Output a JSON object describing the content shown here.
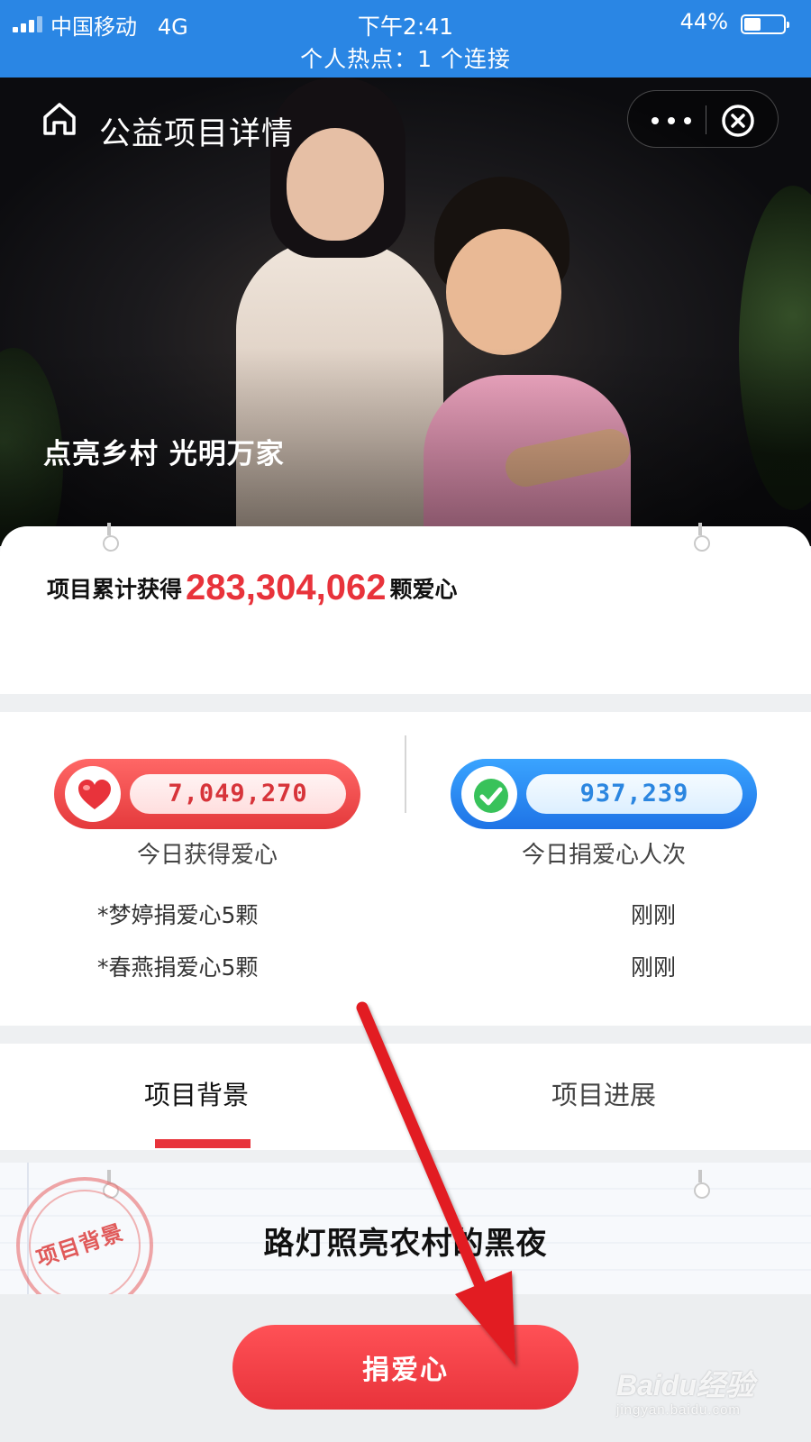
{
  "status_bar": {
    "carrier": "中国移动",
    "network": "4G",
    "time": "下午2:41",
    "battery_percent": "44%",
    "battery_level": 0.44,
    "hotspot": "个人热点：1 个连接",
    "color": "#2a86e4"
  },
  "nav": {
    "title": "公益项目详情",
    "home_icon": "home-icon",
    "more_icon": "more-icon",
    "close_icon": "close-icon"
  },
  "hero": {
    "slogan": "点亮乡村 光明万家"
  },
  "total": {
    "prefix": "项目累计获得",
    "value": "283,304,062",
    "suffix": "颗爱心",
    "value_color": "#e8333b"
  },
  "stats": {
    "today_hearts": {
      "value": "7,049,270",
      "label": "今日获得爱心",
      "icon": "heart-icon",
      "color": "#e8333b"
    },
    "today_donors": {
      "value": "937,239",
      "label": "今日捐爱心人次",
      "icon": "check-icon",
      "color": "#2b86e0"
    }
  },
  "feed": [
    {
      "name": "*梦婷捐爱心5颗",
      "time": "刚刚"
    },
    {
      "name": "*春燕捐爱心5颗",
      "time": "刚刚"
    }
  ],
  "tabs": [
    {
      "label": "项目背景",
      "active": true
    },
    {
      "label": "项目进展",
      "active": false
    }
  ],
  "content": {
    "stamp": "项目背景",
    "story_title": "路灯照亮农村的黑夜"
  },
  "donate_button": "捐爱心",
  "watermark": {
    "logo": "Baidu经验",
    "url": "jingyan.baidu.com"
  }
}
